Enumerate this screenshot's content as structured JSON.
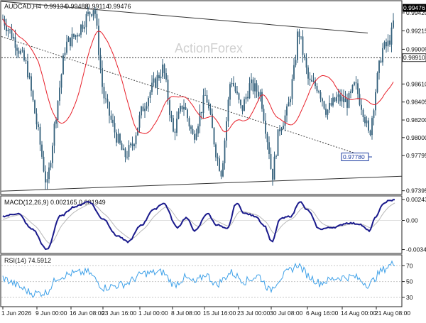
{
  "chart_data": [
    {
      "type": "candlestick",
      "symbol": "AUDCAD,H4",
      "ohlc_header": {
        "open": "0.99134",
        "high": "0.99488",
        "low": "0.99114",
        "close": "0.99476"
      },
      "watermark": "ActionForex",
      "ylim": [
        0.9736,
        0.9955
      ],
      "y_ticks": [
        "0.99420",
        "0.99215",
        "0.99005",
        "0.98610",
        "0.98405",
        "0.98200",
        "0.98000",
        "0.97795",
        "0.97395"
      ],
      "last_price_label": "0.99476",
      "hline_label": "0.98910",
      "hline_value": 0.9891,
      "low_annotation": "0.97780",
      "low_annotation_value": 0.9778,
      "moving_average": {
        "color": "#e8202a"
      },
      "candle_color": "#34607c",
      "x_tick_labels": [
        "1 Jun 2026",
        "9 Jun 00:00",
        "16 Jun 08:00",
        "23 Jun 16:00",
        "1 Jul 00:00",
        "8 Jul 08:00",
        "15 Jul 16:00",
        "23 Jul 00:00",
        "30 Jul 08:00",
        "6 Aug 16:00",
        "14 Aug 00:00",
        "21 Aug 08:00"
      ],
      "trendlines": [
        {
          "name": "upper",
          "from": [
            "1 Jun",
            0.9955
          ],
          "to": [
            "21 Aug",
            0.9919
          ]
        },
        {
          "name": "lower",
          "from": [
            "1 Jun",
            0.9739
          ],
          "to": [
            "24 Aug",
            0.9756
          ]
        },
        {
          "name": "dotted",
          "from": [
            "1 Jun",
            0.9915
          ],
          "to": [
            "20 Aug",
            0.9778
          ]
        }
      ]
    },
    {
      "type": "line",
      "title": "MACD(12,26,9) 0.002165 0.001949",
      "y_ticks": [
        "0.00243",
        "0.00",
        "-0.003413"
      ],
      "ylim": [
        -0.0037,
        0.0027
      ],
      "series_colors": {
        "macd": "#1a1a8c",
        "signal": "#b8b8b8"
      }
    },
    {
      "type": "line",
      "title": "RSI(14) 74.5912",
      "y_ticks": [
        "70",
        "50",
        "30"
      ],
      "ylim": [
        20,
        82
      ],
      "series_colors": {
        "rsi": "#3da0e8"
      }
    }
  ]
}
